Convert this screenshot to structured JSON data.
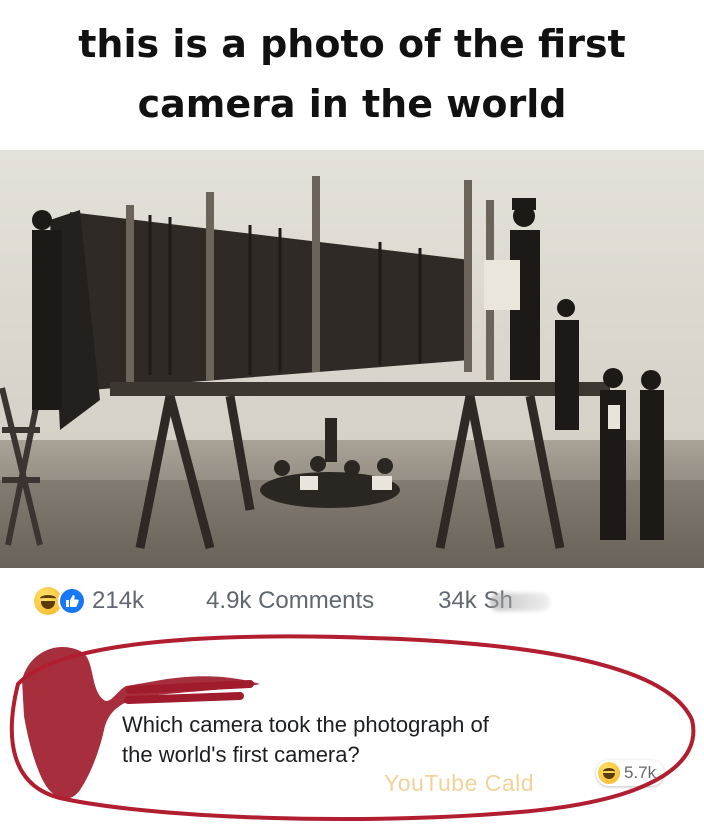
{
  "caption": {
    "line1": "this is a photo of the first",
    "line2": "camera in the world"
  },
  "stats": {
    "likes": "214k",
    "comments": "4.9k Comments",
    "shares": "34k Sh"
  },
  "comment": {
    "line1": "Which camera took the photograph of",
    "line2": "the world's first camera?",
    "reaction_count": "5.7k"
  },
  "watermark": "YouTube Cald",
  "colors": {
    "like_blue": "#1877f2",
    "scribble_red": "#b01e2f",
    "emoji_yellow": "#f7b125"
  },
  "icons": {
    "like": "thumbs-up-icon",
    "laugh": "laugh-emoji-icon"
  }
}
